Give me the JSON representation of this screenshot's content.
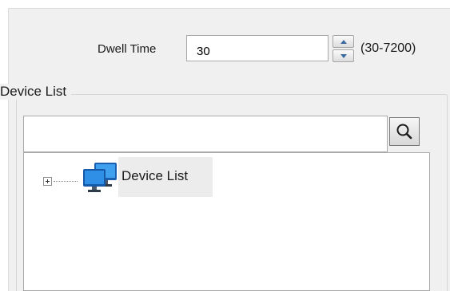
{
  "dwell": {
    "label": "Dwell Time",
    "value": "30",
    "range": "(30-7200)"
  },
  "device_group": {
    "title": "Device List",
    "search": {
      "value": "",
      "placeholder": ""
    },
    "tree": [
      {
        "label": "Device List",
        "expanded": false,
        "icon": "monitors-icon"
      }
    ]
  },
  "colors": {
    "panel_bg": "#f0f0f0",
    "input_border": "#a9a9a9",
    "icon_blue": "#1f78d1"
  }
}
